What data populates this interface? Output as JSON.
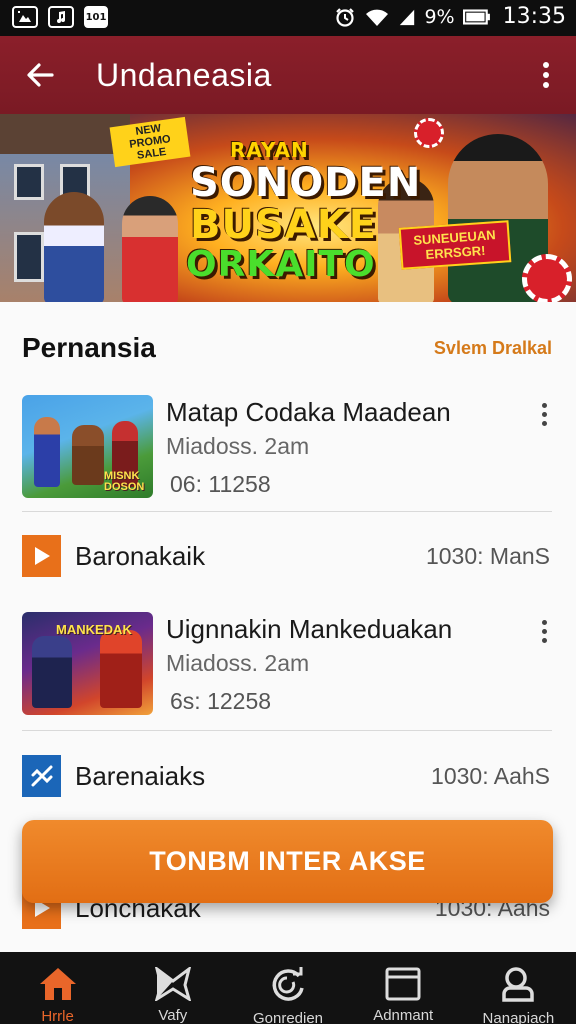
{
  "status_bar": {
    "time": "13:35",
    "battery_text": "9%",
    "left_icons": [
      "photo-icon",
      "music-icon",
      "notification-101-icon"
    ],
    "notification_box_text": "101",
    "right_icons": [
      "alarm-icon",
      "wifi-icon",
      "signal-icon",
      "battery-icon"
    ]
  },
  "app_bar": {
    "title": "Undaneasia",
    "back_icon": "arrow-back-icon",
    "overflow_icon": "more-vert-icon",
    "color": "#8b1f2a"
  },
  "banner": {
    "tag": "NEW PROMO SALE",
    "line1": "RAYAN",
    "line2": "SONODEN",
    "line3": "BUSAKE",
    "line4": "ORKAITO",
    "sign_text": "SUNEUEUAN ERRSGR!"
  },
  "section": {
    "title": "Pernansia",
    "link": "Svlem Dralkal"
  },
  "items": [
    {
      "title": "Matap Codaka Maadean",
      "subtitle": "Miadoss. 2am",
      "meta": "06: 11258",
      "thumb_caption": "MISNK DOSON"
    },
    {
      "title": "Uignnakin Mankeduakan",
      "subtitle": "Miadoss. 2am",
      "meta": "6s: 12258",
      "thumb_caption": "MANKEDAK"
    }
  ],
  "links": [
    {
      "label": "Baronakaik",
      "value": "1030: ManS",
      "icon": "play-icon"
    },
    {
      "label": "Barenaiaks",
      "value": "1030: AahS",
      "icon": "tools-icon"
    },
    {
      "label": "Lonchakak",
      "value": "1030: Aahs",
      "icon": "play-icon"
    }
  ],
  "cta": {
    "label": "TONBM INTER AKSE",
    "color": "#ee8124"
  },
  "bottom_nav": [
    {
      "label": "Hrrle",
      "icon": "home-icon",
      "active": true
    },
    {
      "label": "Vafy",
      "icon": "bowtie-icon",
      "active": false
    },
    {
      "label": "Gonredien",
      "icon": "refresh-icon",
      "active": false
    },
    {
      "label": "Adnmant",
      "icon": "window-icon",
      "active": false
    },
    {
      "label": "Nanapiach",
      "icon": "person-icon",
      "active": false
    }
  ],
  "accent_color": "#e9662a"
}
